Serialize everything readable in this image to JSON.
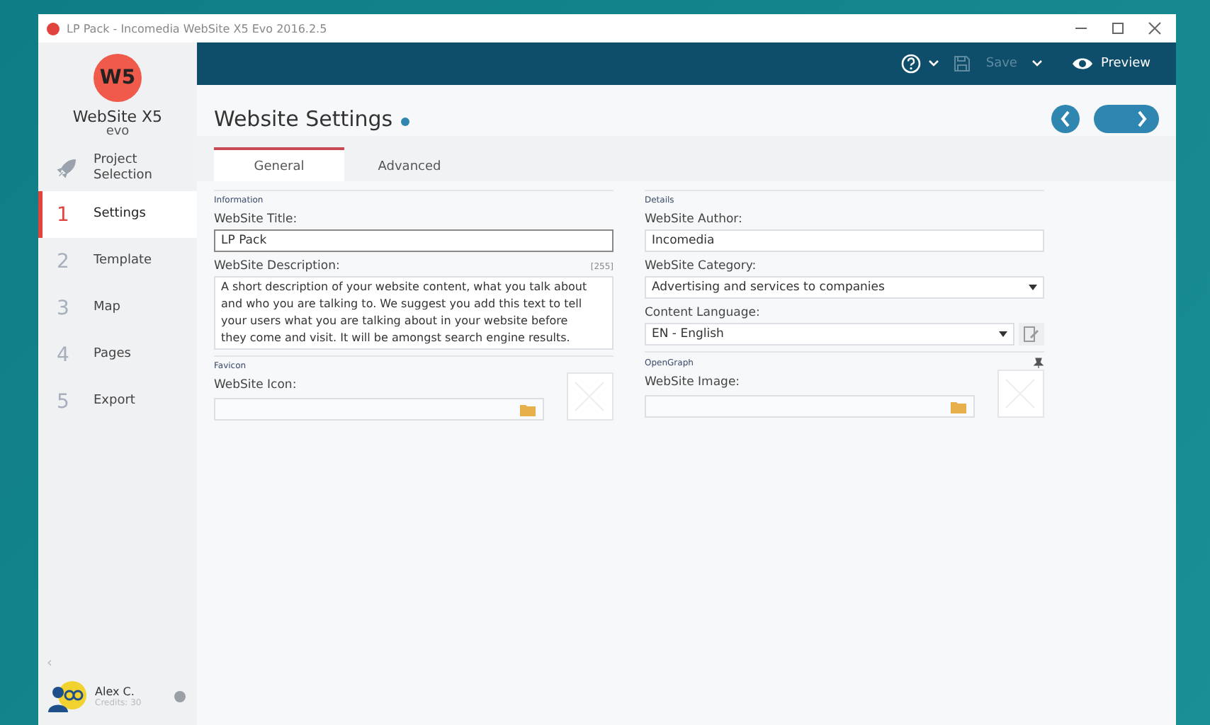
{
  "window": {
    "title": "LP Pack - Incomedia WebSite X5 Evo 2016.2.5"
  },
  "logo": {
    "mark": "W5",
    "name": "WebSite X5",
    "edition": "evo"
  },
  "sidebar": {
    "items": [
      {
        "kind": "icon",
        "label": "Project Selection",
        "selected": false
      },
      {
        "kind": "step",
        "number": "1",
        "label": "Settings",
        "selected": true
      },
      {
        "kind": "step",
        "number": "2",
        "label": "Template",
        "selected": false
      },
      {
        "kind": "step",
        "number": "3",
        "label": "Map",
        "selected": false
      },
      {
        "kind": "step",
        "number": "4",
        "label": "Pages",
        "selected": false
      },
      {
        "kind": "step",
        "number": "5",
        "label": "Export",
        "selected": false
      }
    ],
    "collapse": "‹",
    "user": {
      "name": "Alex C.",
      "credits": "Credits: 30"
    }
  },
  "toolbar": {
    "save": {
      "label": "Save",
      "disabled": true
    },
    "preview": {
      "label": "Preview"
    }
  },
  "page": {
    "title": "Website Settings",
    "tabs": [
      {
        "label": "General",
        "selected": true
      },
      {
        "label": "Advanced",
        "selected": false
      }
    ],
    "columns": [
      [
        {
          "heading": "Information",
          "fields": [
            {
              "kind": "text",
              "label": "WebSite Title:",
              "value": "LP Pack",
              "focused": true
            },
            {
              "kind": "textarea",
              "label": "WebSite Description:",
              "counter": "[255]",
              "value": "A short description  of your website content, what you talk about and who you are talking to. We suggest you add  this text to tell your users what you are talking about in your website before they come and visit. It will be amongst search engine results."
            }
          ]
        },
        {
          "heading": "Favicon",
          "fields": [
            {
              "kind": "file",
              "label": "WebSite Icon:"
            }
          ]
        }
      ],
      [
        {
          "heading": "Details",
          "fields": [
            {
              "kind": "text",
              "label": "WebSite Author:",
              "value": "Incomedia",
              "focused": false
            },
            {
              "kind": "select",
              "label": "WebSite Category:",
              "value": "Advertising and services to companies"
            },
            {
              "kind": "select-edit",
              "label": "Content Language:",
              "value": "EN - English"
            }
          ]
        },
        {
          "heading": "OpenGraph",
          "fields": [
            {
              "kind": "file",
              "label": "WebSite Image:"
            }
          ]
        }
      ]
    ]
  }
}
